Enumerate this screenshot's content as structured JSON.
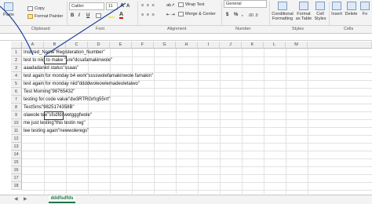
{
  "ribbon": {
    "clipboard": {
      "paste_label": "Paste",
      "copy_label": "Copy",
      "format_painter_label": "Format Painter",
      "group_label": "Clipboard"
    },
    "font": {
      "font_name": "Calibri",
      "font_size": "11",
      "bold": "B",
      "italic": "I",
      "underline": "U",
      "group_label": "Font"
    },
    "alignment": {
      "wrap_text_label": "Wrap Text",
      "merge_center_label": "Merge & Center",
      "group_label": "Alignment"
    },
    "number": {
      "format_value": "General",
      "currency_symbol": "$",
      "percent_symbol": "%",
      "comma_symbol": ",",
      "group_label": "Number"
    },
    "styles": {
      "conditional_formatting_label": "Conditional Formatting",
      "format_as_table_label": "Format as Table",
      "cell_styles_label": "Cell Styles",
      "group_label": "Styles"
    },
    "cells": {
      "insert_label": "Insert",
      "delete_label": "Delete",
      "format_label": "Fo",
      "group_label": "Cells"
    }
  },
  "grid": {
    "columns": [
      "A",
      "B",
      "C",
      "D",
      "E",
      "F",
      "G",
      "H",
      "I",
      "J",
      "K",
      "L",
      "M"
    ],
    "rows": [
      "1",
      "2",
      "3",
      "4",
      "5",
      "6",
      "7",
      "8",
      "9",
      "10",
      "11",
      "12",
      "13",
      "14",
      "15",
      "16",
      "17",
      "18"
    ],
    "cells": [
      "Insured_Name\"Registeration_Number\"",
      "test to niid to make \"ure\"dcsafamakinwole\"",
      "aaadadaniid status\"ssaas\"",
      "test again for monday b4 work\"sssswolefamakinwole famakin\"",
      "test again for monday niid\"ddddwoleowlemadeoletaiwo\"",
      "Test Morning\"98765432\"",
      "testing for code value\"dw3RTRGrfrg55rrt\"",
      "TestSms\"9825174358B\"",
      "olawole tee\"sfsdfdswetgggfwole\"",
      "me just testing\"this testin reg\"",
      "tee testing again\"newwoleregs\""
    ]
  },
  "sheet": {
    "tab_name": "dddfsdfds"
  },
  "colors": {
    "accent": "#217346",
    "ribbon_bg": "#f3f3f3",
    "annotation": "#1f3f9a"
  }
}
